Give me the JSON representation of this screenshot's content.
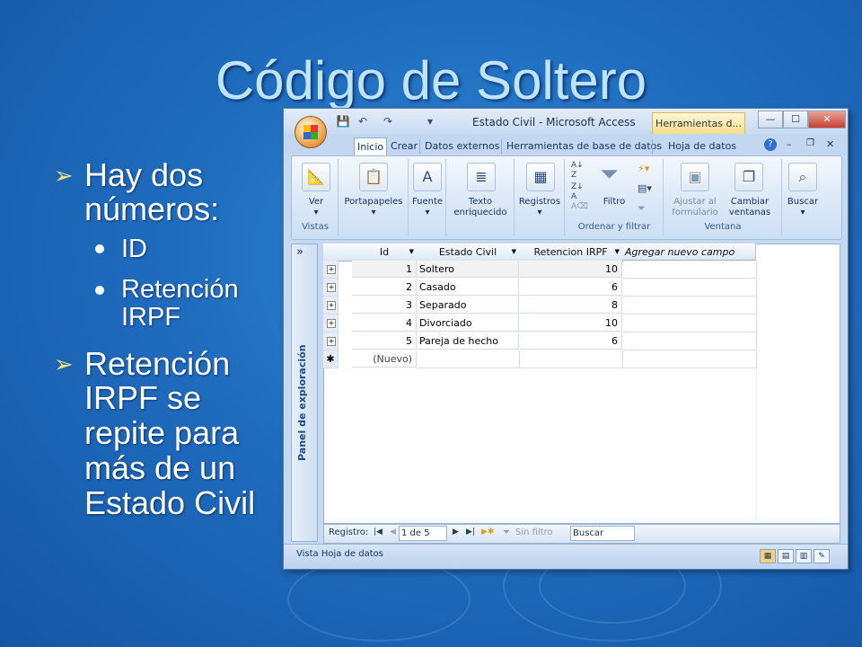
{
  "slide": {
    "title": "Código de Soltero",
    "bullet1": "Hay dos números:",
    "bullet1_line1": "Hay dos",
    "bullet1_line2": "números:",
    "sub1": "ID",
    "sub2_line1": "Retención",
    "sub2_line2": "IRPF",
    "bullet2_lines": [
      "Retención",
      "IRPF se",
      "repite para",
      "más de un",
      "Estado Civil"
    ]
  },
  "window": {
    "title": "Estado Civil - Microsoft Access",
    "context_tab": "Herramientas d...",
    "controls": [
      "—",
      "☐",
      "✕"
    ]
  },
  "ribbon": {
    "tabs": [
      "Inicio",
      "Crear",
      "Datos externos",
      "Herramientas de base de datos",
      "Hoja de datos"
    ],
    "active_tab": "Inicio",
    "groups": {
      "vistas": {
        "label": "Vistas",
        "button": "Ver"
      },
      "portapapeles": "Portapapeles",
      "fuente": "Fuente",
      "texto": {
        "line1": "Texto",
        "line2": "enriquecido"
      },
      "registros": "Registros",
      "ordenar": {
        "label": "Ordenar y filtrar",
        "button": "Filtro"
      },
      "ventana": {
        "label": "Ventana",
        "ajustar1": "Ajustar al",
        "ajustar2": "formulario",
        "cambiar1": "Cambiar",
        "cambiar2": "ventanas"
      },
      "buscar": "Buscar"
    }
  },
  "nav_pane": {
    "label": "Panel de exploración",
    "chevron": "»"
  },
  "datasheet": {
    "columns": [
      "Id",
      "Estado Civil",
      "Retencion IRPF",
      "Agregar nuevo campo"
    ],
    "rows": [
      {
        "id": "1",
        "estado": "Soltero",
        "irpf": "10"
      },
      {
        "id": "2",
        "estado": "Casado",
        "irpf": "6"
      },
      {
        "id": "3",
        "estado": "Separado",
        "irpf": "8"
      },
      {
        "id": "4",
        "estado": "Divorciado",
        "irpf": "10"
      },
      {
        "id": "5",
        "estado": "Pareja de hecho",
        "irpf": "6"
      }
    ],
    "new_row": "(Nuevo)"
  },
  "record_nav": {
    "label": "Registro:",
    "position": "1 de 5",
    "filter": "Sin filtro",
    "search": "Buscar"
  },
  "status": {
    "text": "Vista Hoja de datos"
  }
}
